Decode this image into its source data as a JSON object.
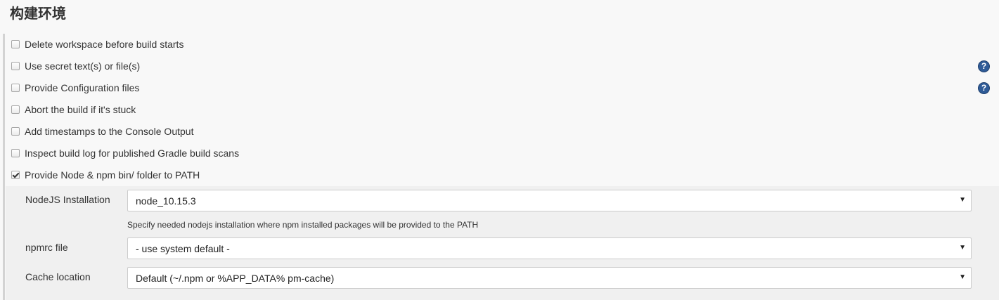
{
  "section": {
    "title": "构建环境"
  },
  "options": [
    {
      "label": "Delete workspace before build starts",
      "checked": false,
      "has_help": false
    },
    {
      "label": "Use secret text(s) or file(s)",
      "checked": false,
      "has_help": true
    },
    {
      "label": "Provide Configuration files",
      "checked": false,
      "has_help": true
    },
    {
      "label": "Abort the build if it's stuck",
      "checked": false,
      "has_help": false
    },
    {
      "label": "Add timestamps to the Console Output",
      "checked": false,
      "has_help": false
    },
    {
      "label": "Inspect build log for published Gradle build scans",
      "checked": false,
      "has_help": false
    },
    {
      "label": "Provide Node & npm bin/ folder to PATH",
      "checked": true,
      "has_help": false
    }
  ],
  "help_glyph": "?",
  "node_config": {
    "installation": {
      "label": "NodeJS Installation",
      "value": "node_10.15.3",
      "hint": "Specify needed nodejs installation where npm installed packages will be provided to the PATH"
    },
    "npmrc": {
      "label": "npmrc file",
      "value": "- use system default -"
    },
    "cache": {
      "label": "Cache location",
      "value": "Default (~/.npm or %APP_DATA% pm-cache)"
    },
    "dropdown_arrow": "▼"
  },
  "colors": {
    "page_background": "#f8f8f8",
    "subpanel_background": "#f0f0f0",
    "help_icon": "#2f5b97",
    "text": "#333333"
  }
}
